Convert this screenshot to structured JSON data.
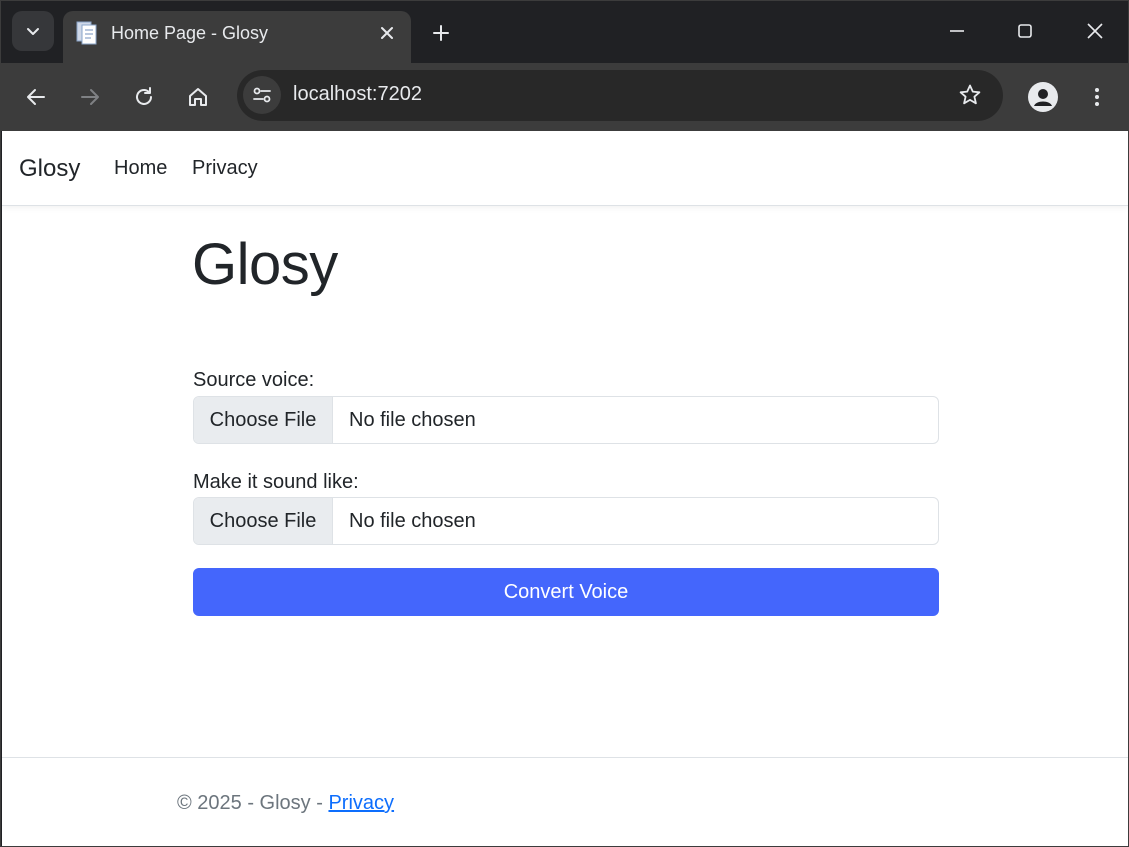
{
  "browser": {
    "tab_title": "Home Page - Glosy",
    "url": "localhost:7202"
  },
  "navbar": {
    "brand": "Glosy",
    "links": [
      "Home",
      "Privacy"
    ]
  },
  "main": {
    "title": "Glosy",
    "source_label": "Source voice:",
    "target_label": "Make it sound like:",
    "choose_file_label": "Choose File",
    "no_file_text": "No file chosen",
    "convert_label": "Convert Voice"
  },
  "footer": {
    "text": "© 2025 - Glosy - ",
    "link": "Privacy"
  },
  "colors": {
    "primary_button": "#4466fc",
    "link": "#0d6efd",
    "chrome_dark": "#202124",
    "chrome_toolbar": "#3c3c3c"
  }
}
